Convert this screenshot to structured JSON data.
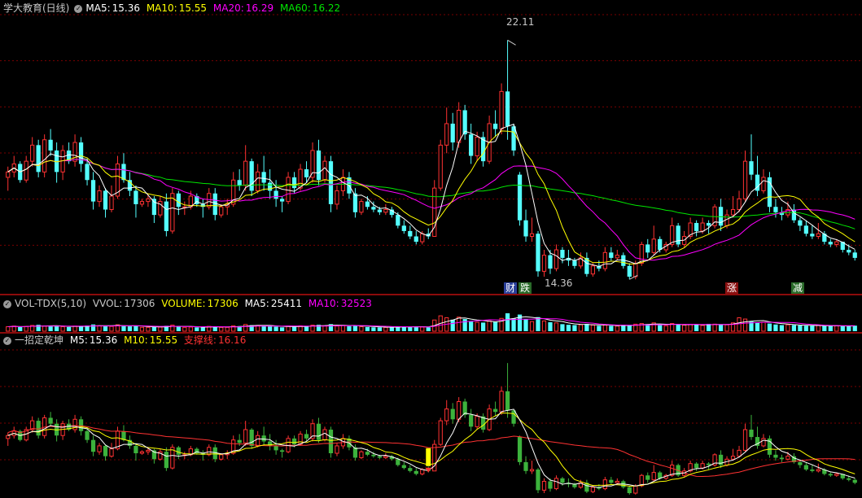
{
  "price_header": {
    "title": "学大教育(日线)",
    "ma5_label": "MA5:",
    "ma5": "15.36",
    "ma10_label": "MA10:",
    "ma10": "15.55",
    "ma20_label": "MA20:",
    "ma20": "16.29",
    "ma60_label": "MA60:",
    "ma60": "16.22"
  },
  "price_annotations": {
    "high": "22.11",
    "low": "14.36"
  },
  "event_tags": [
    "财",
    "跌",
    "涨",
    "减"
  ],
  "vol_header": {
    "title": "VOL-TDX(5,10)",
    "vvol_label": "VVOL:",
    "vvol": "17306",
    "volume_label": "VOLUME:",
    "volume": "17306",
    "ma5_label": "MA5:",
    "ma5": "25411",
    "ma10_label": "MA10:",
    "ma10": "32523"
  },
  "ind_header": {
    "title": "一招定乾坤",
    "m5_label": "M5:",
    "m5": "15.36",
    "m10_label": "M10:",
    "m10": "15.55",
    "support_label": "支撑线:",
    "support": "16.16"
  },
  "colors": {
    "up": "#ff3232",
    "down": "#54ffff",
    "ind_down": "#3cb23c",
    "ma5": "#ffffff",
    "ma10": "#ffff00",
    "ma20": "#ff00ff",
    "ma60": "#00e600",
    "support": "#ff3232",
    "grid": "#7a0000"
  },
  "chart_data": {
    "type": "candlestick",
    "y_range": [
      13.3,
      23.0
    ],
    "candles": [
      [
        17.0,
        17.4,
        16.5,
        17.2
      ],
      [
        17.2,
        17.8,
        17.0,
        17.5
      ],
      [
        17.5,
        17.6,
        16.8,
        16.9
      ],
      [
        16.9,
        17.8,
        16.8,
        17.6
      ],
      [
        17.6,
        18.5,
        17.4,
        18.2
      ],
      [
        18.2,
        18.4,
        17.0,
        17.2
      ],
      [
        17.2,
        18.6,
        17.0,
        18.4
      ],
      [
        18.4,
        18.8,
        17.8,
        18.0
      ],
      [
        18.0,
        18.3,
        16.8,
        17.2
      ],
      [
        17.2,
        18.2,
        16.9,
        18.0
      ],
      [
        18.0,
        18.3,
        17.5,
        17.6
      ],
      [
        17.6,
        18.6,
        17.4,
        18.3
      ],
      [
        18.3,
        18.5,
        17.2,
        17.5
      ],
      [
        17.5,
        17.7,
        16.7,
        16.9
      ],
      [
        16.9,
        17.2,
        15.8,
        16.1
      ],
      [
        16.1,
        16.7,
        15.9,
        16.5
      ],
      [
        16.5,
        16.6,
        15.5,
        15.8
      ],
      [
        15.8,
        16.7,
        15.7,
        16.3
      ],
      [
        16.3,
        17.8,
        16.2,
        17.5
      ],
      [
        17.5,
        17.9,
        16.8,
        16.9
      ],
      [
        16.9,
        17.2,
        16.3,
        16.5
      ],
      [
        16.5,
        16.7,
        15.5,
        16.0
      ],
      [
        16.0,
        16.2,
        15.9,
        16.1
      ],
      [
        16.1,
        16.4,
        15.9,
        16.2
      ],
      [
        16.2,
        16.3,
        15.3,
        15.6
      ],
      [
        15.6,
        16.3,
        15.5,
        16.1
      ],
      [
        16.1,
        16.4,
        14.8,
        15.0
      ],
      [
        15.0,
        16.6,
        14.9,
        16.4
      ],
      [
        16.4,
        16.5,
        15.6,
        15.9
      ],
      [
        15.9,
        16.1,
        15.6,
        15.9
      ],
      [
        15.9,
        16.5,
        15.8,
        16.3
      ],
      [
        16.3,
        16.4,
        15.9,
        16.0
      ],
      [
        16.0,
        16.2,
        15.5,
        15.9
      ],
      [
        15.9,
        16.6,
        15.8,
        16.4
      ],
      [
        16.4,
        16.6,
        15.4,
        15.6
      ],
      [
        15.6,
        16.0,
        15.5,
        15.9
      ],
      [
        15.9,
        16.2,
        15.6,
        16.0
      ],
      [
        16.0,
        17.2,
        15.9,
        16.9
      ],
      [
        16.9,
        17.3,
        16.5,
        16.7
      ],
      [
        16.7,
        18.2,
        16.5,
        17.6
      ],
      [
        17.6,
        17.7,
        16.3,
        16.5
      ],
      [
        16.5,
        17.5,
        16.4,
        17.2
      ],
      [
        17.2,
        17.8,
        16.5,
        16.8
      ],
      [
        16.8,
        17.3,
        16.2,
        16.5
      ],
      [
        16.5,
        16.9,
        15.9,
        16.2
      ],
      [
        16.2,
        16.3,
        15.7,
        16.1
      ],
      [
        16.1,
        17.2,
        16.0,
        17.0
      ],
      [
        17.0,
        17.2,
        16.4,
        16.6
      ],
      [
        16.6,
        17.5,
        16.5,
        17.3
      ],
      [
        17.3,
        17.6,
        16.8,
        17.0
      ],
      [
        17.0,
        18.3,
        16.8,
        18.0
      ],
      [
        18.0,
        18.4,
        16.7,
        16.9
      ],
      [
        16.9,
        17.8,
        16.8,
        17.6
      ],
      [
        17.6,
        17.8,
        15.7,
        16.0
      ],
      [
        16.0,
        16.7,
        15.8,
        16.5
      ],
      [
        16.5,
        17.3,
        16.3,
        17.0
      ],
      [
        17.0,
        17.2,
        16.2,
        16.4
      ],
      [
        16.4,
        16.6,
        15.5,
        15.7
      ],
      [
        15.7,
        16.2,
        15.6,
        16.1
      ],
      [
        16.1,
        16.3,
        15.8,
        15.9
      ],
      [
        15.9,
        16.1,
        15.7,
        15.8
      ],
      [
        15.8,
        15.9,
        15.6,
        15.7
      ],
      [
        15.7,
        16.0,
        15.6,
        15.8
      ],
      [
        15.8,
        15.9,
        15.5,
        15.6
      ],
      [
        15.6,
        15.7,
        15.1,
        15.2
      ],
      [
        15.2,
        15.4,
        14.9,
        15.0
      ],
      [
        15.0,
        15.2,
        14.7,
        14.8
      ],
      [
        14.8,
        15.0,
        14.5,
        14.6
      ],
      [
        14.6,
        15.0,
        14.5,
        14.9
      ],
      [
        14.9,
        15.1,
        14.7,
        14.8
      ],
      [
        14.8,
        16.9,
        14.8,
        16.6
      ],
      [
        16.6,
        18.4,
        16.5,
        18.2
      ],
      [
        18.2,
        19.6,
        17.9,
        19.0
      ],
      [
        19.0,
        19.4,
        18.0,
        18.3
      ],
      [
        18.3,
        19.8,
        18.1,
        19.5
      ],
      [
        19.5,
        19.7,
        18.4,
        18.6
      ],
      [
        18.6,
        19.0,
        17.5,
        17.8
      ],
      [
        17.8,
        18.7,
        17.6,
        18.5
      ],
      [
        18.5,
        18.7,
        17.4,
        17.6
      ],
      [
        17.6,
        19.3,
        17.5,
        19.0
      ],
      [
        19.0,
        19.5,
        18.5,
        18.8
      ],
      [
        18.8,
        20.5,
        18.6,
        20.2
      ],
      [
        20.2,
        22.11,
        18.4,
        18.9
      ],
      [
        18.9,
        19.0,
        17.8,
        18.0
      ],
      [
        17.1,
        17.2,
        15.2,
        15.4
      ],
      [
        15.4,
        15.8,
        14.6,
        14.8
      ],
      [
        14.8,
        15.5,
        14.6,
        14.9
      ],
      [
        14.9,
        15.0,
        13.3,
        13.5
      ],
      [
        13.5,
        14.3,
        13.3,
        14.1
      ],
      [
        14.1,
        14.3,
        13.4,
        13.6
      ],
      [
        13.6,
        14.5,
        13.5,
        14.3
      ],
      [
        14.3,
        14.4,
        13.8,
        14.0
      ],
      [
        14.0,
        14.3,
        13.7,
        13.9
      ],
      [
        13.9,
        14.0,
        13.6,
        13.7
      ],
      [
        13.7,
        14.2,
        13.6,
        14.0
      ],
      [
        14.0,
        14.2,
        13.3,
        13.4
      ],
      [
        13.4,
        13.8,
        13.3,
        13.7
      ],
      [
        13.7,
        13.9,
        13.5,
        13.6
      ],
      [
        13.6,
        14.4,
        13.5,
        14.2
      ],
      [
        14.2,
        14.4,
        13.9,
        14.0
      ],
      [
        14.0,
        14.3,
        13.9,
        14.1
      ],
      [
        14.1,
        14.2,
        13.6,
        13.7
      ],
      [
        13.7,
        13.8,
        13.2,
        13.3
      ],
      [
        13.3,
        13.9,
        13.2,
        13.8
      ],
      [
        13.8,
        14.6,
        13.7,
        14.5
      ],
      [
        14.5,
        14.7,
        14.0,
        14.2
      ],
      [
        14.2,
        15.2,
        14.1,
        14.7
      ],
      [
        14.7,
        14.8,
        14.2,
        14.3
      ],
      [
        14.3,
        14.6,
        14.2,
        14.5
      ],
      [
        14.5,
        15.5,
        14.4,
        15.2
      ],
      [
        15.2,
        15.3,
        14.4,
        14.5
      ],
      [
        14.5,
        15.0,
        14.4,
        14.8
      ],
      [
        14.8,
        15.5,
        14.7,
        15.3
      ],
      [
        15.3,
        15.4,
        14.8,
        15.0
      ],
      [
        15.0,
        15.5,
        14.9,
        15.3
      ],
      [
        15.3,
        15.4,
        14.9,
        15.2
      ],
      [
        15.2,
        16.0,
        15.1,
        15.9
      ],
      [
        15.9,
        16.2,
        15.0,
        15.2
      ],
      [
        15.2,
        15.8,
        15.1,
        15.6
      ],
      [
        15.6,
        16.3,
        15.5,
        15.8
      ],
      [
        15.8,
        16.5,
        15.7,
        16.2
      ],
      [
        16.2,
        18.0,
        16.1,
        17.6
      ],
      [
        17.6,
        18.6,
        16.9,
        17.1
      ],
      [
        17.1,
        17.8,
        16.3,
        16.5
      ],
      [
        16.5,
        17.3,
        16.4,
        17.0
      ],
      [
        17.0,
        17.2,
        15.7,
        15.9
      ],
      [
        15.9,
        16.2,
        15.5,
        15.7
      ],
      [
        15.7,
        15.9,
        15.4,
        15.6
      ],
      [
        15.6,
        16.1,
        15.5,
        15.8
      ],
      [
        15.8,
        16.0,
        15.3,
        15.4
      ],
      [
        15.4,
        15.5,
        15.0,
        15.2
      ],
      [
        15.2,
        15.4,
        14.8,
        14.9
      ],
      [
        14.9,
        15.2,
        14.7,
        14.8
      ],
      [
        14.8,
        15.3,
        14.7,
        14.9
      ],
      [
        14.9,
        15.0,
        14.5,
        14.6
      ],
      [
        14.6,
        14.7,
        14.4,
        14.5
      ],
      [
        14.5,
        14.7,
        14.4,
        14.6
      ],
      [
        14.6,
        14.6,
        14.2,
        14.3
      ],
      [
        14.3,
        14.5,
        14.1,
        14.2
      ],
      [
        14.2,
        14.3,
        13.9,
        14.0
      ]
    ],
    "volume": [
      14000,
      16000,
      13000,
      15000,
      18000,
      20000,
      16000,
      15000,
      17000,
      14000,
      13000,
      16000,
      15000,
      18000,
      21000,
      17000,
      16000,
      15000,
      20000,
      18000,
      15000,
      16000,
      12000,
      12000,
      14000,
      13000,
      17000,
      19000,
      14000,
      12000,
      13000,
      12000,
      13000,
      15000,
      14000,
      12000,
      12000,
      17000,
      16000,
      21000,
      19000,
      18000,
      17000,
      15000,
      14000,
      12000,
      16000,
      14000,
      17000,
      15000,
      19000,
      20000,
      17000,
      22000,
      16000,
      18000,
      16000,
      18000,
      14000,
      13000,
      12000,
      12000,
      12000,
      13000,
      15000,
      14000,
      14000,
      14000,
      13000,
      12000,
      35000,
      48000,
      42000,
      36000,
      44000,
      38000,
      30000,
      28000,
      27000,
      32000,
      30000,
      40000,
      56000,
      40000,
      52000,
      38000,
      30000,
      44000,
      32000,
      28000,
      26000,
      22000,
      20000,
      19000,
      20000,
      23000,
      19000,
      17000,
      19000,
      17000,
      16000,
      20000,
      18000,
      22000,
      24000,
      22000,
      26000,
      19000,
      17000,
      24000,
      22000,
      19000,
      21000,
      20000,
      18000,
      23000,
      22000,
      21000,
      20000,
      26000,
      42000,
      38000,
      30000,
      27000,
      28000,
      24000,
      21000,
      19000,
      20000,
      19000,
      18000,
      17000,
      17000,
      18000,
      16000,
      16000,
      17000,
      16000,
      17000,
      17306
    ]
  }
}
